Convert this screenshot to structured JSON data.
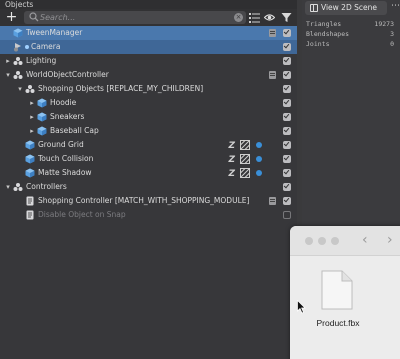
{
  "objects_panel": {
    "title": "Objects",
    "add_label": "+",
    "search": {
      "placeholder": "Search..."
    }
  },
  "tree": [
    {
      "label": "TweenManager",
      "depth": 0,
      "arrow": "",
      "icon": "cube-icon",
      "selected": true,
      "lock": true,
      "checked": true
    },
    {
      "label": "Camera",
      "depth": 0,
      "arrow": "",
      "icon": "camera-icon",
      "selected": true,
      "dot": true,
      "checked": true
    },
    {
      "label": "Lighting",
      "depth": 0,
      "arrow": "▸",
      "icon": "lighting-icon",
      "checked": true
    },
    {
      "label": "WorldObjectController",
      "depth": 0,
      "arrow": "▾",
      "icon": "scene-object-icon",
      "lock": true,
      "checked": true
    },
    {
      "label": "Shopping Objects [REPLACE_MY_CHILDREN]",
      "depth": 1,
      "arrow": "▾",
      "icon": "scene-object-icon",
      "checked": true
    },
    {
      "label": "Hoodie",
      "depth": 2,
      "arrow": "▸",
      "icon": "cube-icon",
      "checked": true
    },
    {
      "label": "Sneakers",
      "depth": 2,
      "arrow": "▸",
      "icon": "cube-icon",
      "checked": true
    },
    {
      "label": "Baseball Cap",
      "depth": 2,
      "arrow": "▸",
      "icon": "cube-icon",
      "checked": true
    },
    {
      "label": "Ground Grid",
      "depth": 1,
      "arrow": "",
      "icon": "cube-icon",
      "badges": true,
      "checked": true
    },
    {
      "label": "Touch Collision",
      "depth": 1,
      "arrow": "",
      "icon": "cube-icon",
      "badges": true,
      "checked": true
    },
    {
      "label": "Matte Shadow",
      "depth": 1,
      "arrow": "",
      "icon": "cube-icon",
      "badges": true,
      "checked": true
    },
    {
      "label": "Controllers",
      "depth": 0,
      "arrow": "▾",
      "icon": "scene-object-icon",
      "checked": true
    },
    {
      "label": "Shopping Controller [MATCH_WITH_SHOPPING_MODULE]",
      "depth": 1,
      "arrow": "",
      "icon": "script-icon",
      "lock": true,
      "checked": true
    },
    {
      "label": "Disable Object on Snap",
      "depth": 1,
      "arrow": "",
      "icon": "script-icon",
      "dim": true,
      "checked": false
    }
  ],
  "badge_text": "Z",
  "scene_panel": {
    "view_button_label": "View 2D Scene",
    "more_label": "⋯",
    "stats": [
      {
        "label": "Triangles",
        "value": "19273"
      },
      {
        "label": "Blendshapes",
        "value": "3"
      },
      {
        "label": "Joints",
        "value": "0"
      }
    ]
  },
  "finder": {
    "back_label": "‹",
    "forward_label": "›",
    "file_name": "Product.fbx"
  },
  "colors": {
    "panel_bg": "#37373a",
    "selection": "#3f6797",
    "accent_dot": "#3a8fd8"
  }
}
